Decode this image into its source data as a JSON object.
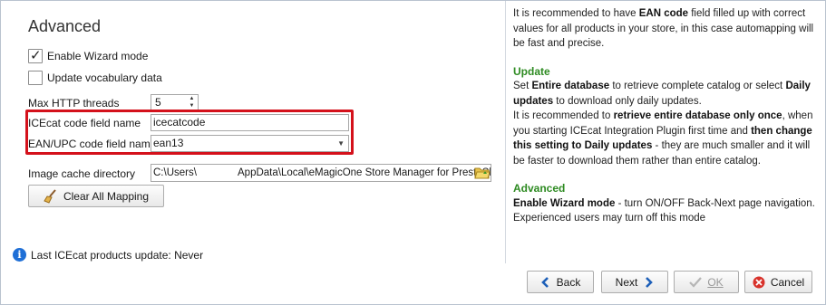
{
  "panel": {
    "title": "Advanced",
    "enable_wizard_label": "Enable Wizard mode",
    "enable_wizard_checked": true,
    "update_vocab_label": "Update vocabulary data",
    "update_vocab_checked": false,
    "max_http_label": "Max HTTP threads",
    "max_http_value": "5",
    "icecat_field_label": "ICEcat code field name",
    "icecat_field_value": "icecatcode",
    "ean_field_label": "EAN/UPC code field name",
    "ean_field_value": "ean13",
    "image_cache_label": "Image cache directory",
    "image_cache_path_start": "C:\\Users\\",
    "image_cache_path_end": "AppData\\Local\\eMagicOne Store Manager for PrestaSh",
    "clear_mapping_label": "Clear All Mapping",
    "status_text": "Last ICEcat products update: Never"
  },
  "help": {
    "p1_a": "It is recommended to have ",
    "p1_b": "EAN code",
    "p1_c": " field filled up with correct values for all products in your store, in this case automapping will be fast and precise.",
    "update_title": "Update",
    "u1_a": "Set ",
    "u1_b": "Entire database",
    "u1_c": " to retrieve complete catalog or select ",
    "u1_d": "Daily updates",
    "u1_e": " to download only daily updates.",
    "u2_a": "It is recommended to ",
    "u2_b": "retrieve entire database only once",
    "u2_c": ", when you starting ICEcat Integration Plugin first time and ",
    "u2_d": "then change this setting to Daily updates",
    "u2_e": " - they are much smaller and it will be faster to download them rather than entire catalog.",
    "advanced_title": "Advanced",
    "a1_a": "Enable Wizard mode",
    "a1_b": " - turn ON/OFF Back-Next page navigation. Experienced users may turn off this mode"
  },
  "buttons": {
    "back": "Back",
    "next": "Next",
    "ok": "OK",
    "cancel": "Cancel"
  },
  "colors": {
    "highlight_border": "#d4111b",
    "section_title": "#2e8b22",
    "info_icon": "#1f6fd6"
  }
}
